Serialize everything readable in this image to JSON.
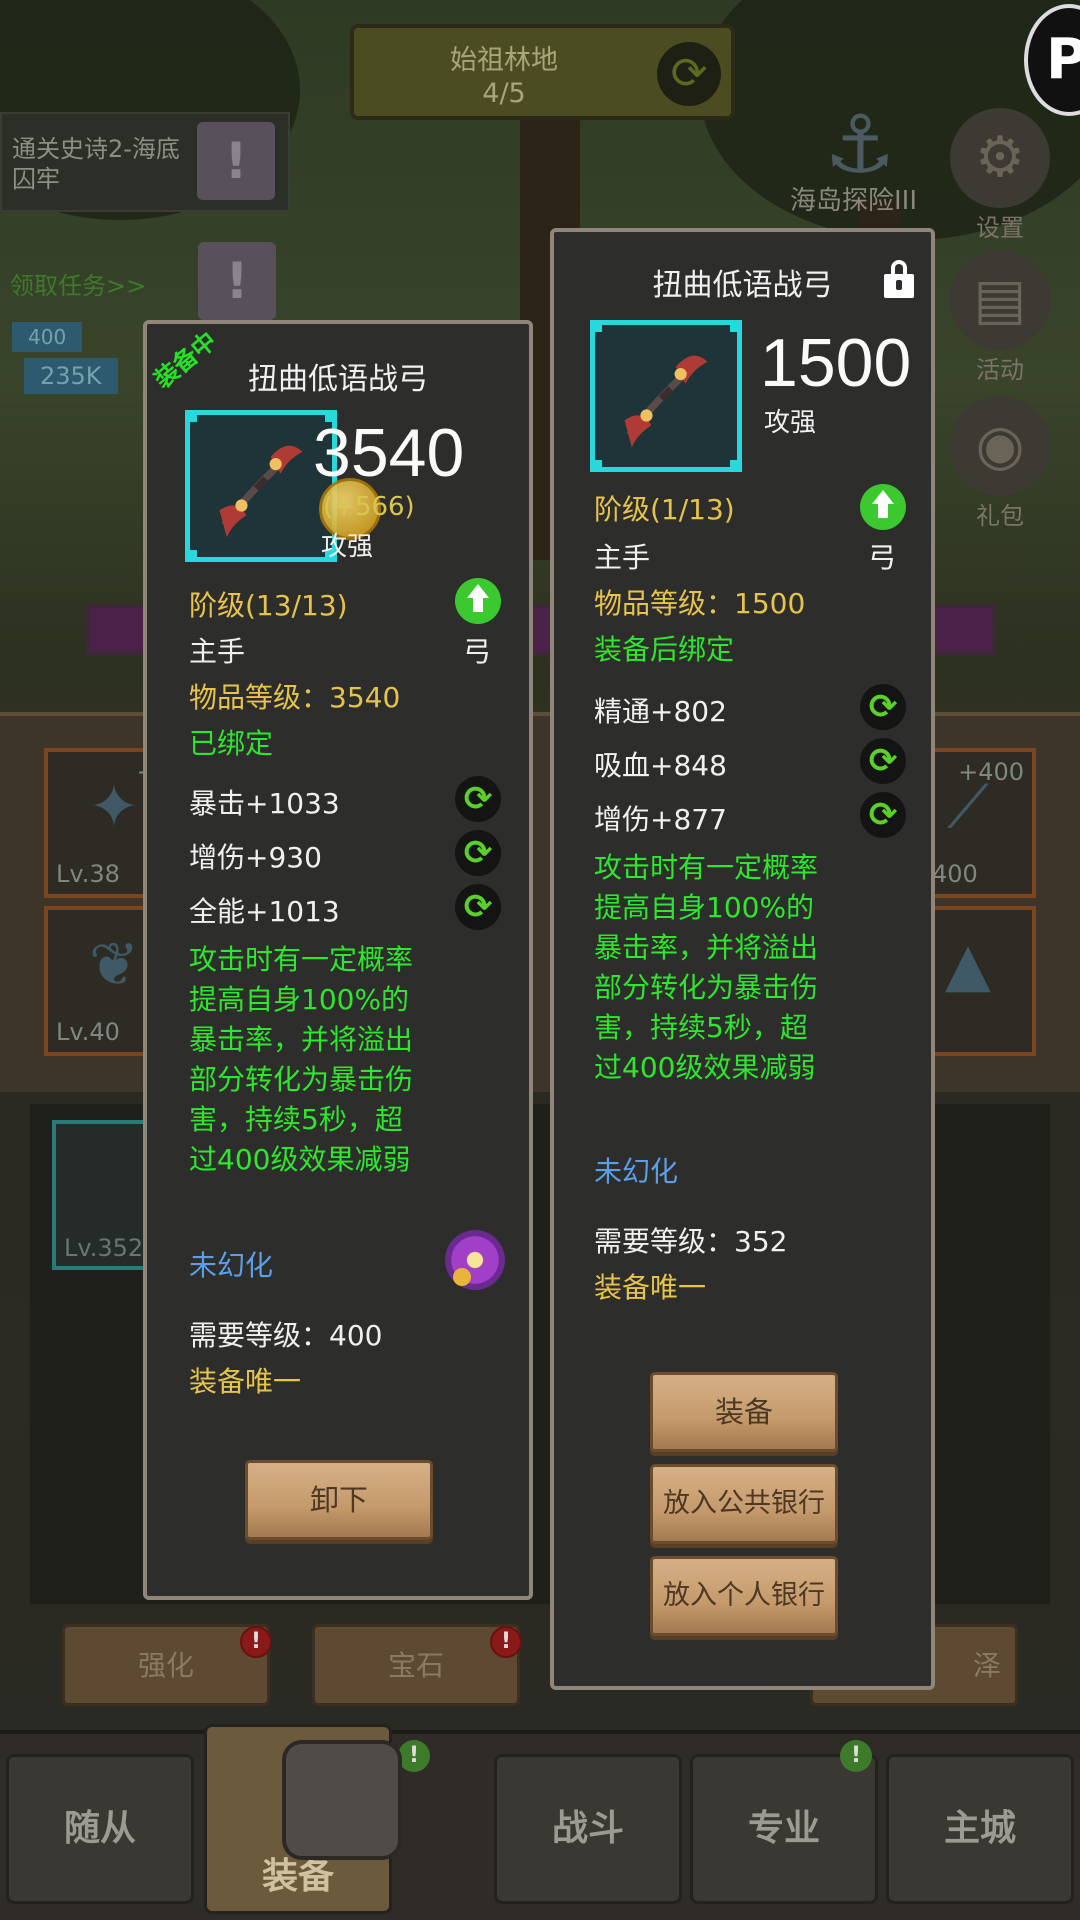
{
  "background": {
    "zone": {
      "name": "始祖林地",
      "progress": "4/5"
    },
    "quest": {
      "text": "通关史诗2-海底囚牢",
      "link": "领取任务>>"
    },
    "stats": {
      "small_value": "400",
      "power": "235K"
    },
    "side_buttons": {
      "island_label": "海岛探险III",
      "settings": "设置",
      "activity": "活动",
      "gift": "礼包"
    },
    "slots": [
      {
        "level": "Lv.38",
        "plus": "+4"
      },
      {
        "level": "Lv.40",
        "plus": ""
      },
      {
        "level": "v.400",
        "plus": "+400"
      },
      {
        "level": "",
        "plus": ""
      }
    ],
    "inventory_item_level": "Lv.352",
    "action_buttons": [
      "强化",
      "宝石",
      "",
      "泽"
    ],
    "badge_alert": "!",
    "nav": [
      "随从",
      "装备",
      "战斗",
      "专业",
      "主城"
    ],
    "nav_active": "装备"
  },
  "equipped_panel": {
    "tag": "装备中",
    "title": "扭曲低语战弓",
    "score": "3540",
    "delta": "(+566)",
    "score_label": "攻强",
    "rank": "阶级(13/13)",
    "slot": "主手",
    "weapon_type": "弓",
    "item_level": "物品等级：3540",
    "bind_status": "已绑定",
    "stats": [
      "暴击+1033",
      "增伤+930",
      "全能+1013"
    ],
    "description": [
      "攻击时有一定概率",
      "提高自身100%的",
      "暴击率，并将溢出",
      "部分转化为暴击伤",
      "害，持续5秒，超",
      "过400级效果减弱"
    ],
    "illusion": "未幻化",
    "required_level": "需要等级：400",
    "unique": "装备唯一",
    "button": "卸下",
    "icons": {
      "item": "twisted-bow-icon",
      "upgrade": "upgrade-arrow-icon",
      "reroll": "reroll-icon",
      "illusion": "illusion-orb-icon"
    }
  },
  "new_panel": {
    "title": "扭曲低语战弓",
    "score": "1500",
    "score_label": "攻强",
    "rank": "阶级(1/13)",
    "slot": "主手",
    "weapon_type": "弓",
    "item_level": "物品等级：1500",
    "bind_status": "装备后绑定",
    "stats": [
      "精通+802",
      "吸血+848",
      "增伤+877"
    ],
    "description": [
      "攻击时有一定概率",
      "提高自身100%的",
      "暴击率，并将溢出",
      "部分转化为暴击伤",
      "害，持续5秒，超",
      "过400级效果减弱"
    ],
    "illusion": "未幻化",
    "required_level": "需要等级：352",
    "unique": "装备唯一",
    "buttons": [
      "装备",
      "放入公共银行",
      "放入个人银行"
    ],
    "icons": {
      "item": "twisted-bow-icon",
      "lock": "lock-icon",
      "upgrade": "upgrade-arrow-icon",
      "reroll": "reroll-icon"
    }
  },
  "colors": {
    "panel_bg": "#2d2d2b",
    "panel_border": "#8f8679",
    "frame": "#27d8dc",
    "gold_text": "#e6c34c",
    "green_text": "#2ee62e",
    "blue_text": "#5a9fe8"
  }
}
